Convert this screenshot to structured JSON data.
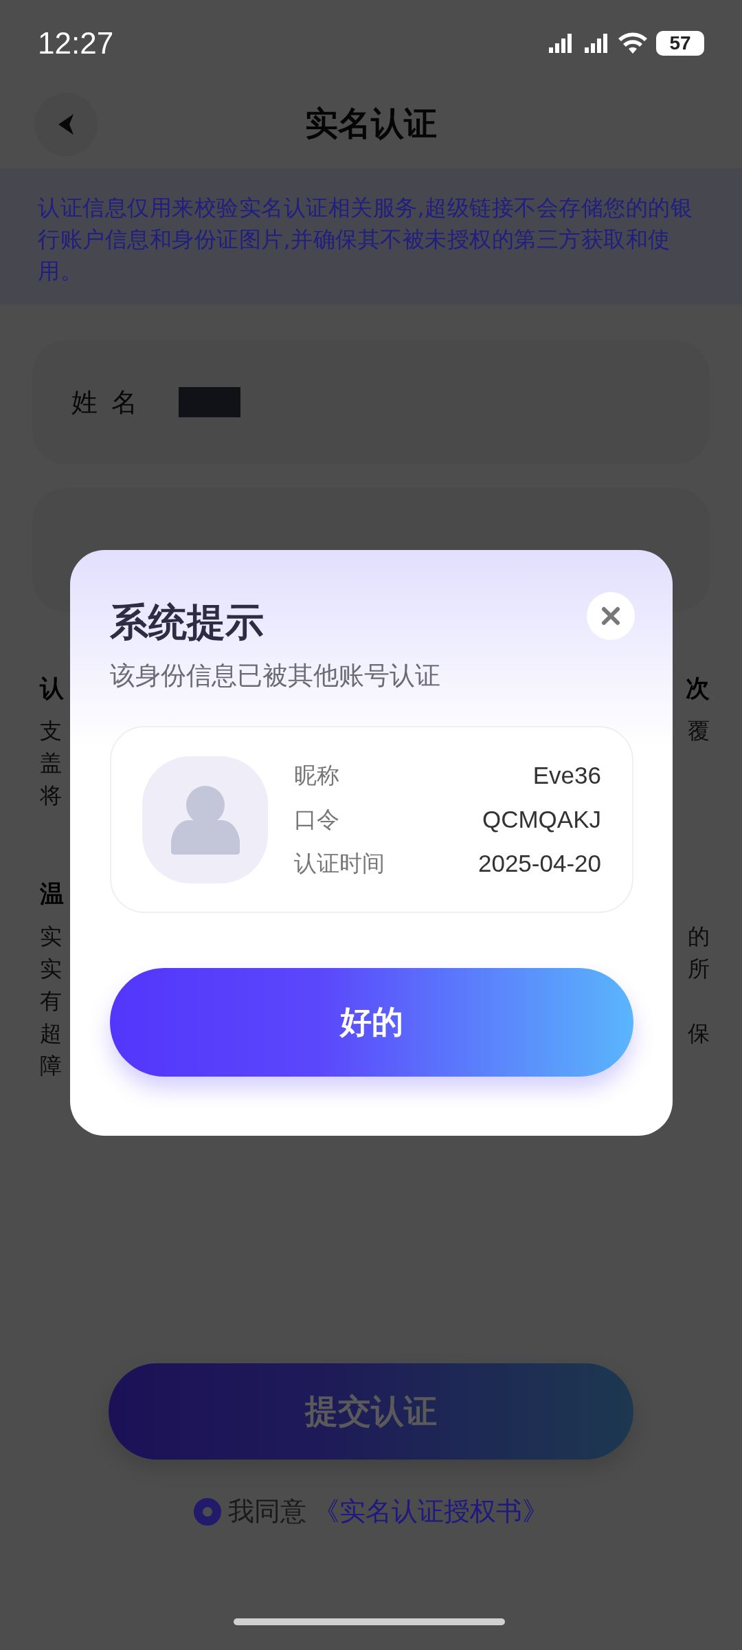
{
  "status_bar": {
    "time": "12:27",
    "battery": "57"
  },
  "nav": {
    "title": "实名认证"
  },
  "notice": {
    "text": "认证信息仅用来校验实名认证相关服务,超级链接不会存储您的的银行账户信息和身份证图片,并确保其不被未授权的第三方获取和使用。"
  },
  "form": {
    "name_label": "姓名"
  },
  "tips_fragments": [
    {
      "kind": "heading",
      "left": "认",
      "right": "次"
    },
    {
      "kind": "line",
      "left": "支",
      "right": "覆"
    },
    {
      "kind": "line",
      "left": "盖"
    },
    {
      "kind": "line",
      "left": "将"
    },
    {
      "kind": "gap"
    },
    {
      "kind": "heading",
      "left": "温"
    },
    {
      "kind": "line",
      "left": "实",
      "right": "的"
    },
    {
      "kind": "line",
      "left": "实",
      "right": "所"
    },
    {
      "kind": "line",
      "left": "有"
    },
    {
      "kind": "line",
      "left": "超",
      "right": "保"
    },
    {
      "kind": "line",
      "left": "障"
    }
  ],
  "submit": {
    "label": "提交认证"
  },
  "agree": {
    "checked": true,
    "text": "我同意",
    "link": "《实名认证授权书》"
  },
  "dialog": {
    "title": "系统提示",
    "subtitle": "该身份信息已被其他账号认证",
    "rows": [
      {
        "label": "昵称",
        "value": "Eve36"
      },
      {
        "label": "口令",
        "value": "QCMQAKJ"
      },
      {
        "label": "认证时间",
        "value": "2025-04-20"
      }
    ],
    "ok": "好的"
  }
}
